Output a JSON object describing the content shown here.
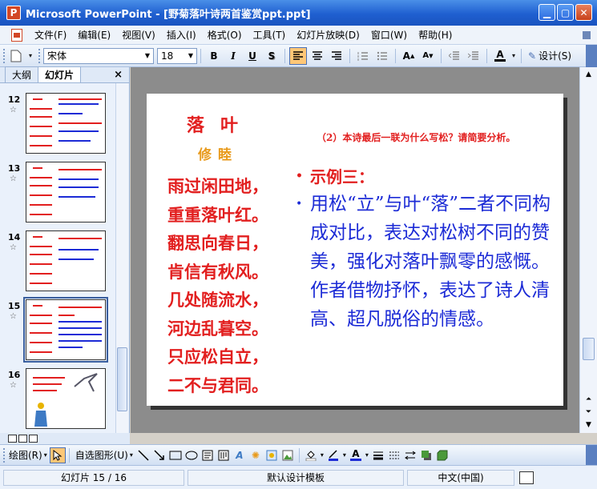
{
  "window": {
    "app_icon": "P",
    "title": "Microsoft PowerPoint - [野菊落叶诗两首鉴赏ppt.ppt]",
    "min_label": "▁",
    "max_label": "▢",
    "close_label": "✕"
  },
  "menu": {
    "items": [
      "文件(F)",
      "编辑(E)",
      "视图(V)",
      "插入(I)",
      "格式(O)",
      "工具(T)",
      "幻灯片放映(D)",
      "窗口(W)",
      "帮助(H)"
    ]
  },
  "toolbar": {
    "font_name": "宋体",
    "font_size": "18",
    "bold": "B",
    "italic": "I",
    "underline": "U",
    "design_label": "设计(S)"
  },
  "outline_pane": {
    "tabs": [
      "大纲",
      "幻灯片"
    ],
    "close_label": "×",
    "slides": [
      {
        "number": "12"
      },
      {
        "number": "13"
      },
      {
        "number": "14"
      },
      {
        "number": "15"
      },
      {
        "number": "16"
      }
    ]
  },
  "slide": {
    "poem_title": "落叶",
    "poem_author": "修睦",
    "poem_lines": [
      "雨过闲田地，",
      "重重落叶红。",
      "翻思向春日，",
      "肯信有秋风。",
      "几处随流水，",
      "河边乱暮空。",
      "只应松自立，",
      "二不与君同。"
    ],
    "question": "（2）本诗最后一联为什么写松？请简要分析。",
    "example_label": "示例三：",
    "answer": "用松“立”与叶“落”二者不同构成对比，表达对松树不同的赞美，强化对落叶飘零的感慨。作者借物抒怀，表达了诗人清高、超凡脱俗的情感。",
    "colors": {
      "red": "#e21f1f",
      "orange": "#e89a1c",
      "blue": "#1c2bd6"
    }
  },
  "drawing_toolbar": {
    "draw_label": "绘图(R)",
    "autoshape_label": "自选图形(U)"
  },
  "status": {
    "slide_info": "幻灯片 15 / 16",
    "template": "默认设计模板",
    "language": "中文(中国)"
  }
}
